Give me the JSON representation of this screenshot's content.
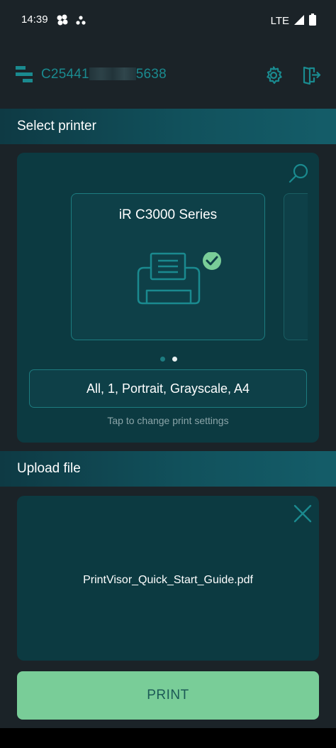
{
  "status_bar": {
    "time": "14:39",
    "network": "LTE",
    "icons": [
      "notification-dots-icon",
      "signal-icon",
      "battery-icon"
    ]
  },
  "header": {
    "account_prefix": "C25441",
    "account_suffix": "5638",
    "icons": [
      "app-logo-icon",
      "gear-icon",
      "logout-icon"
    ]
  },
  "select_printer": {
    "title": "Select printer",
    "printer_name": "iR C3000 Series",
    "pager": {
      "count": 2,
      "active_index": 1
    },
    "settings_summary": "All, 1, Portrait, Grayscale, A4",
    "settings_hint": "Tap to change print settings"
  },
  "upload_file": {
    "title": "Upload file",
    "file_name": "PrintVisor_Quick_Start_Guide.pdf"
  },
  "actions": {
    "print_label": "PRINT"
  },
  "colors": {
    "accent": "#1a8a8f",
    "panel": "#0c3a41",
    "print_button": "#79cd98",
    "check": "#79cd98"
  }
}
